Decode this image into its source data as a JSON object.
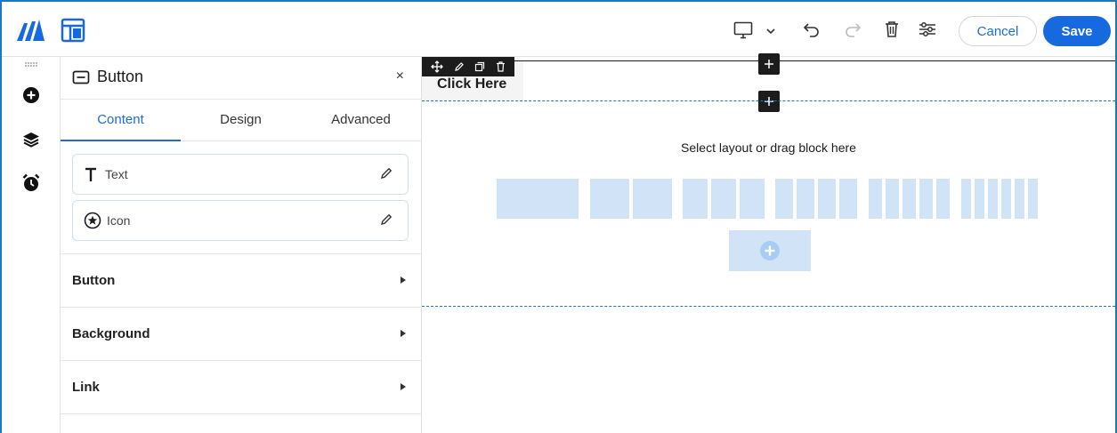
{
  "topbar": {
    "device_icon": "desktop-icon",
    "cancel_label": "Cancel",
    "save_label": "Save"
  },
  "panel": {
    "title": "Button",
    "close_label": "×",
    "tabs": [
      {
        "label": "Content"
      },
      {
        "label": "Design"
      },
      {
        "label": "Advanced"
      }
    ],
    "items": [
      {
        "label": "Text",
        "icon": "text-icon"
      },
      {
        "label": "Icon",
        "icon": "star-circle-icon"
      }
    ],
    "sections": [
      {
        "label": "Button"
      },
      {
        "label": "Background"
      },
      {
        "label": "Link"
      }
    ]
  },
  "canvas": {
    "button_text": "Click Here",
    "drop_label": "Select layout or drag block here"
  },
  "colors": {
    "accent": "#1769e0",
    "frame": "#1a78c2",
    "placeholder": "#d1e4f7"
  }
}
